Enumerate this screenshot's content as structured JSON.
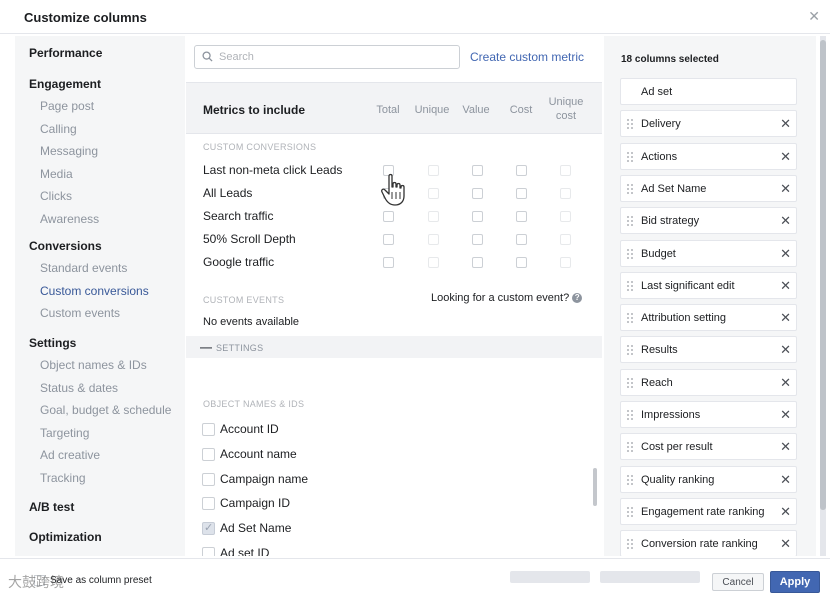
{
  "dialog": {
    "title": "Customize columns",
    "close_icon": "close-icon"
  },
  "nav": {
    "groups": [
      {
        "label": "Performance",
        "items": []
      },
      {
        "label": "Engagement",
        "items": [
          "Page post",
          "Calling",
          "Messaging",
          "Media",
          "Clicks",
          "Awareness"
        ]
      },
      {
        "label": "Conversions",
        "items": [
          "Standard events",
          "Custom conversions",
          "Custom events"
        ]
      },
      {
        "label": "Settings",
        "items": [
          "Object names & IDs",
          "Status & dates",
          "Goal, budget & schedule",
          "Targeting",
          "Ad creative",
          "Tracking"
        ]
      },
      {
        "label": "A/B test",
        "items": []
      },
      {
        "label": "Optimization",
        "items": []
      }
    ],
    "active_item": "Custom conversions"
  },
  "search": {
    "placeholder": "Search",
    "value": ""
  },
  "create_custom_metric": "Create custom metric",
  "metrics": {
    "title": "Metrics to include",
    "columns": [
      "Total",
      "Unique",
      "Value",
      "Cost",
      "Unique cost"
    ],
    "custom_conversions_label": "CUSTOM CONVERSIONS",
    "custom_conversions": [
      "Last non-meta click Leads",
      "All Leads",
      "Search traffic",
      "50% Scroll Depth",
      "Google traffic"
    ],
    "custom_events_label": "CUSTOM EVENTS",
    "custom_event_prompt": "Looking for a custom event?",
    "no_events": "No events available",
    "settings_label": "SETTINGS",
    "object_names_label": "OBJECT NAMES & IDS",
    "object_names": [
      {
        "label": "Account ID",
        "checked": false
      },
      {
        "label": "Account name",
        "checked": false
      },
      {
        "label": "Campaign name",
        "checked": false
      },
      {
        "label": "Campaign ID",
        "checked": false
      },
      {
        "label": "Ad Set Name",
        "checked": true
      },
      {
        "label": "Ad set ID",
        "checked": false
      }
    ]
  },
  "selected": {
    "count_label": "18 columns selected",
    "items": [
      {
        "label": "Ad set",
        "removable": false,
        "draggable": false
      },
      {
        "label": "Delivery",
        "removable": true,
        "draggable": true
      },
      {
        "label": "Actions",
        "removable": true,
        "draggable": true
      },
      {
        "label": "Ad Set Name",
        "removable": true,
        "draggable": true
      },
      {
        "label": "Bid strategy",
        "removable": true,
        "draggable": true
      },
      {
        "label": "Budget",
        "removable": true,
        "draggable": true
      },
      {
        "label": "Last significant edit",
        "removable": true,
        "draggable": true
      },
      {
        "label": "Attribution setting",
        "removable": true,
        "draggable": true
      },
      {
        "label": "Results",
        "removable": true,
        "draggable": true
      },
      {
        "label": "Reach",
        "removable": true,
        "draggable": true
      },
      {
        "label": "Impressions",
        "removable": true,
        "draggable": true
      },
      {
        "label": "Cost per result",
        "removable": true,
        "draggable": true
      },
      {
        "label": "Quality ranking",
        "removable": true,
        "draggable": true
      },
      {
        "label": "Engagement rate ranking",
        "removable": true,
        "draggable": true
      },
      {
        "label": "Conversion rate ranking",
        "removable": true,
        "draggable": true
      }
    ]
  },
  "footer": {
    "save_preset": "Save as column preset",
    "cancel": "Cancel",
    "apply": "Apply"
  },
  "watermark": "大鼓跨境",
  "colors": {
    "accent": "#4267b2",
    "link": "#385898",
    "muted": "#8d949e"
  }
}
